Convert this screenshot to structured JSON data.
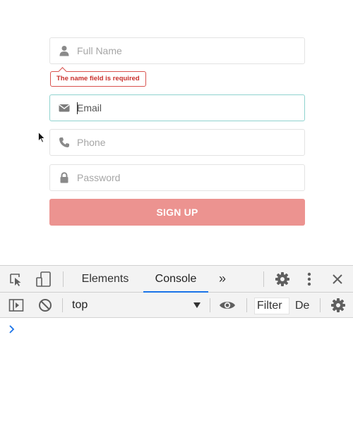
{
  "form": {
    "full_name": {
      "placeholder": "Full Name",
      "icon": "user-icon"
    },
    "error_message": "The name field is required",
    "email": {
      "placeholder": "Email",
      "icon": "envelope-icon"
    },
    "phone": {
      "placeholder": "Phone",
      "icon": "phone-icon"
    },
    "password": {
      "placeholder": "Password",
      "icon": "lock-icon"
    },
    "submit_label": "SIGN UP",
    "colors": {
      "button": "#ec9390",
      "error": "#d9534f",
      "focus_border": "#8fd3cf"
    }
  },
  "devtools": {
    "tabs": [
      "Elements",
      "Console"
    ],
    "active_tab": "Console",
    "more_tabs_label": "»",
    "context": "top",
    "filter_placeholder": "Filter",
    "levels_label": "De",
    "accent": "#1a73e8"
  }
}
